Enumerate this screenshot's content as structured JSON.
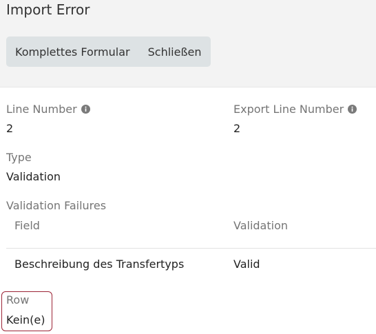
{
  "dialog": {
    "title": "Import Error",
    "buttons": {
      "full_form": "Komplettes Formular",
      "close": "Schließen"
    }
  },
  "fields": {
    "line_number": {
      "label": "Line Number",
      "value": "2"
    },
    "export_line_number": {
      "label": "Export Line Number",
      "value": "2"
    },
    "type": {
      "label": "Type",
      "value": "Validation"
    },
    "row": {
      "label": "Row",
      "value": "Kein(e)"
    }
  },
  "validation_failures": {
    "label": "Validation Failures",
    "columns": [
      "Field",
      "Validation"
    ],
    "rows": [
      [
        "Beschreibung des Transfertyps",
        "Valid"
      ]
    ]
  },
  "colors": {
    "header_bg": "#f3f3f3",
    "button_group_bg": "#dde2e4",
    "highlight_border": "#9b2335",
    "label_gray": "#757575"
  },
  "icons": [
    "info-icon"
  ]
}
